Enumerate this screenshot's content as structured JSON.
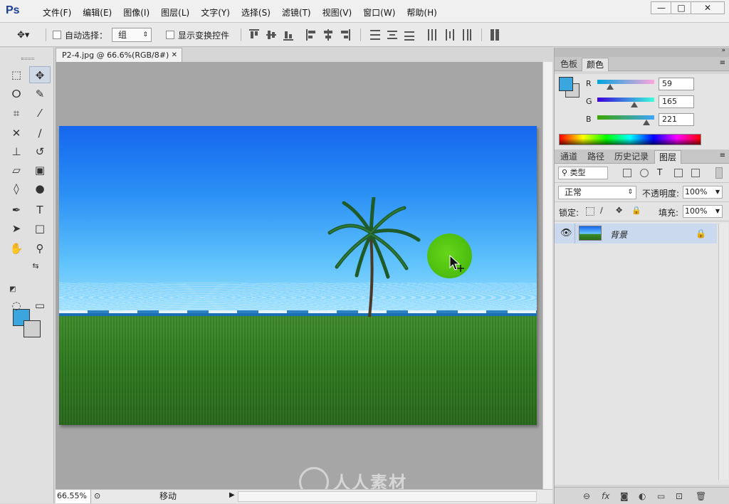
{
  "app": {
    "logo": "Ps"
  },
  "menu": [
    "文件(F)",
    "编辑(E)",
    "图像(I)",
    "图层(L)",
    "文字(Y)",
    "选择(S)",
    "滤镜(T)",
    "视图(V)",
    "窗口(W)",
    "帮助(H)"
  ],
  "window_controls": {
    "minimize": "—",
    "maximize": "□",
    "close": "✕"
  },
  "options": {
    "auto_select_label": "自动选择：",
    "auto_select_value": "组",
    "show_transform_label": "显示变换控件"
  },
  "document": {
    "tab_title": "P2-4.jpg @ 66.6%(RGB/8#)",
    "tab_close": "✕"
  },
  "status": {
    "zoom": "66.55%",
    "info": "移动"
  },
  "color_panel": {
    "tabs": [
      "色板",
      "颜色"
    ],
    "active_tab": "颜色",
    "foreground_hex": "#3BA5DD",
    "channels": [
      {
        "label": "R",
        "value": "59",
        "fraction": 0.231
      },
      {
        "label": "G",
        "value": "165",
        "fraction": 0.647
      },
      {
        "label": "B",
        "value": "221",
        "fraction": 0.867
      }
    ]
  },
  "layers_panel": {
    "tabs": [
      "通道",
      "路径",
      "历史记录",
      "图层"
    ],
    "active_tab": "图层",
    "kind_filter": "类型",
    "blend_mode": "正常",
    "opacity_label": "不透明度:",
    "opacity_value": "100%",
    "lock_label": "锁定:",
    "fill_label": "填充:",
    "fill_value": "100%",
    "layers": [
      {
        "name": "背景",
        "visible": true,
        "locked": true
      }
    ]
  },
  "watermark": "人人素材"
}
